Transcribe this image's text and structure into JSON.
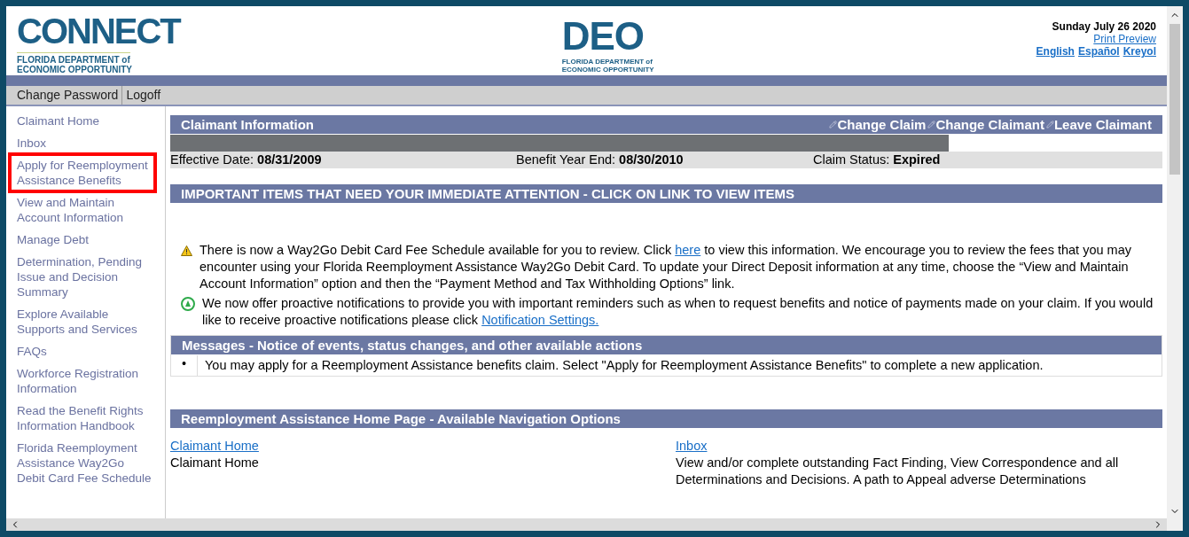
{
  "header": {
    "logo_left": {
      "word": "CONNECT",
      "line1": "FLORIDA DEPARTMENT of",
      "line2": "ECONOMIC OPPORTUNITY"
    },
    "logo_center": {
      "word": "DEO",
      "line1": "FLORIDA DEPARTMENT of",
      "line2": "ECONOMIC OPPORTUNITY"
    },
    "date": "Sunday July 26 2020",
    "print_preview": "Print Preview",
    "languages": [
      "English",
      "Español",
      "Kreyol"
    ]
  },
  "top_links": [
    "Change Password",
    "Logoff"
  ],
  "sidebar": {
    "items": [
      {
        "label": "Claimant Home",
        "highlighted": false
      },
      {
        "label": "Inbox",
        "highlighted": false
      },
      {
        "label": "Apply for Reemployment Assistance Benefits",
        "highlighted": true
      },
      {
        "label": "View and Maintain Account Information",
        "highlighted": false
      },
      {
        "label": "Manage Debt",
        "highlighted": false
      },
      {
        "label": "Determination, Pending Issue and Decision Summary",
        "highlighted": false
      },
      {
        "label": "Explore Available Supports and Services",
        "highlighted": false
      },
      {
        "label": "FAQs",
        "highlighted": false
      },
      {
        "label": "Workforce Registration Information",
        "highlighted": false
      },
      {
        "label": "Read the Benefit Rights Information Handbook",
        "highlighted": false
      },
      {
        "label": "Florida Reemployment Assistance Way2Go Debit Card Fee Schedule",
        "highlighted": false
      }
    ]
  },
  "claimant_info": {
    "title": "Claimant Information",
    "actions": [
      "Change Claim",
      "Change Claimant",
      "Leave Claimant"
    ],
    "fields": [
      {
        "label": "Effective Date:",
        "value": "08/31/2009"
      },
      {
        "label": "Benefit Year End:",
        "value": "08/30/2010"
      },
      {
        "label": "Claim Status:",
        "value": "Expired"
      }
    ]
  },
  "important": {
    "title": "IMPORTANT ITEMS THAT NEED YOUR IMMEDIATE ATTENTION - CLICK ON LINK TO VIEW ITEMS",
    "items": [
      {
        "kind": "warning",
        "before": "There is now a Way2Go Debit Card Fee Schedule available for you to review. Click ",
        "link": "here",
        "after": " to view this information. We encourage you to review the fees that you may encounter using your Florida Reemployment Assistance Way2Go Debit Card. To update your Direct Deposit information at any time, choose the “View and Maintain Account Information” option and then the “Payment Method and Tax Withholding Options” link."
      },
      {
        "kind": "notice",
        "before": "We now offer proactive notifications to provide you with important reminders such as when to request benefits and notice of payments made on your claim. If you would like to receive proactive notifications please click ",
        "link": "Notification Settings."
      }
    ]
  },
  "messages": {
    "title": "Messages - Notice of events, status changes, and other available actions",
    "items": [
      {
        "marker": "•",
        "text": "You may apply for a Reemployment Assistance benefits claim. Select \"Apply for Reemployment Assistance Benefits\" to complete a new application."
      }
    ]
  },
  "navigation": {
    "title": "Reemployment Assistance Home Page - Available Navigation Options",
    "options": [
      {
        "link": "Claimant Home",
        "description": "Claimant Home"
      },
      {
        "link": "Inbox",
        "description": "View and/or complete outstanding Fact Finding, View Correspondence and all Determinations and Decisions. A path to Appeal adverse Determinations"
      }
    ]
  }
}
